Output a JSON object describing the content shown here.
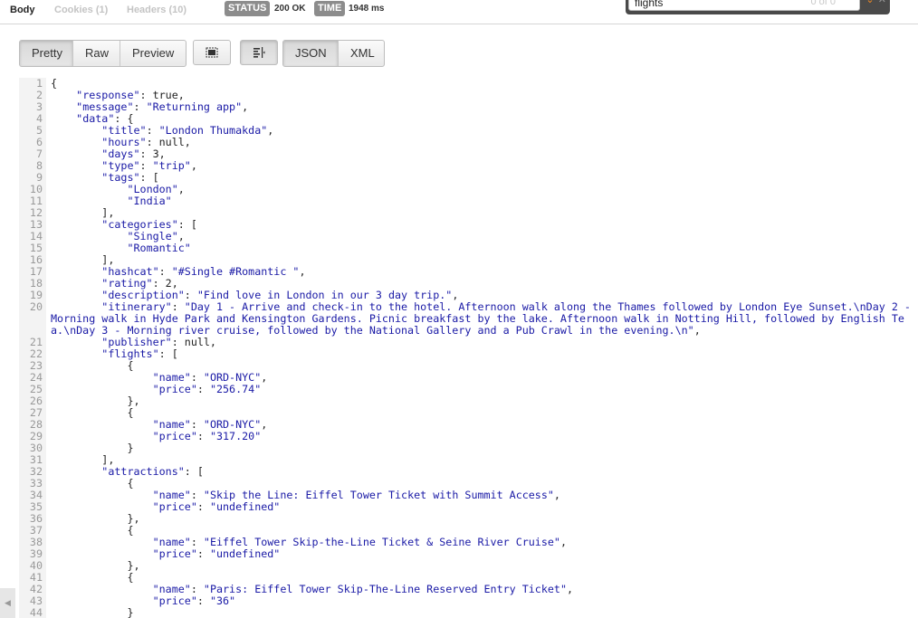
{
  "tabs": {
    "body": "Body",
    "cookies": "Cookies (1)",
    "headers": "Headers (10)"
  },
  "status": {
    "label": "STATUS",
    "value": "200 OK"
  },
  "time": {
    "label": "TIME",
    "value": "1948 ms"
  },
  "search": {
    "query": "flights",
    "count": "0 of 0"
  },
  "toolbar": {
    "pretty": "Pretty",
    "raw": "Raw",
    "preview": "Preview",
    "json": "JSON",
    "xml": "XML",
    "fullscreen_icon": "fullscreen-icon",
    "wrap_icon": "wrap-lines-icon"
  },
  "colors": {
    "accent": "#f08a24",
    "string": "#1a1aa6",
    "badge": "#8c8c8c"
  },
  "code": {
    "line_numbers": [
      "1",
      "2",
      "3",
      "4",
      "5",
      "6",
      "7",
      "8",
      "9",
      "10",
      "11",
      "12",
      "13",
      "14",
      "15",
      "16",
      "17",
      "18",
      "19",
      "20",
      "21",
      "22",
      "23",
      "24",
      "25",
      "26",
      "27",
      "28",
      "29",
      "30",
      "31",
      "32",
      "33",
      "34",
      "35",
      "36",
      "37",
      "38",
      "39",
      "40",
      "41",
      "42",
      "43",
      "44"
    ],
    "lines": [
      "{",
      "    \"response\": true,",
      "    \"message\": \"Returning app\",",
      "    \"data\": {",
      "        \"title\": \"London Thumakda\",",
      "        \"hours\": null,",
      "        \"days\": 3,",
      "        \"type\": \"trip\",",
      "        \"tags\": [",
      "            \"London\",",
      "            \"India\"",
      "        ],",
      "        \"categories\": [",
      "            \"Single\",",
      "            \"Romantic\"",
      "        ],",
      "        \"hashcat\": \"#Single #Romantic \",",
      "        \"rating\": 2,",
      "        \"description\": \"Find love in London in our 3 day trip.\",",
      "        \"itinerary\": \"Day 1 - Arrive and check-in to the hotel. Afternoon walk along the Thames followed by London Eye Sunset.\\nDay 2 - Morning walk in Hyde Park and Kensington Gardens. Picnic breakfast by the lake. Afternoon walk in Notting Hill, followed by English Tea.\\nDay 3 - Morning river cruise, followed by the National Gallery and a Pub Crawl in the evening.\\n\",",
      "        \"publisher\": null,",
      "        \"flights\": [",
      "            {",
      "                \"name\": \"ORD-NYC\",",
      "                \"price\": \"256.74\"",
      "            },",
      "            {",
      "                \"name\": \"ORD-NYC\",",
      "                \"price\": \"317.20\"",
      "            }",
      "        ],",
      "        \"attractions\": [",
      "            {",
      "                \"name\": \"Skip the Line: Eiffel Tower Ticket with Summit Access\",",
      "                \"price\": \"undefined\"",
      "            },",
      "            {",
      "                \"name\": \"Eiffel Tower Skip-the-Line Ticket & Seine River Cruise\",",
      "                \"price\": \"undefined\"",
      "            },",
      "            {",
      "                \"name\": \"Paris: Eiffel Tower Skip-The-Line Reserved Entry Ticket\",",
      "                \"price\": \"36\"",
      "            }"
    ]
  }
}
